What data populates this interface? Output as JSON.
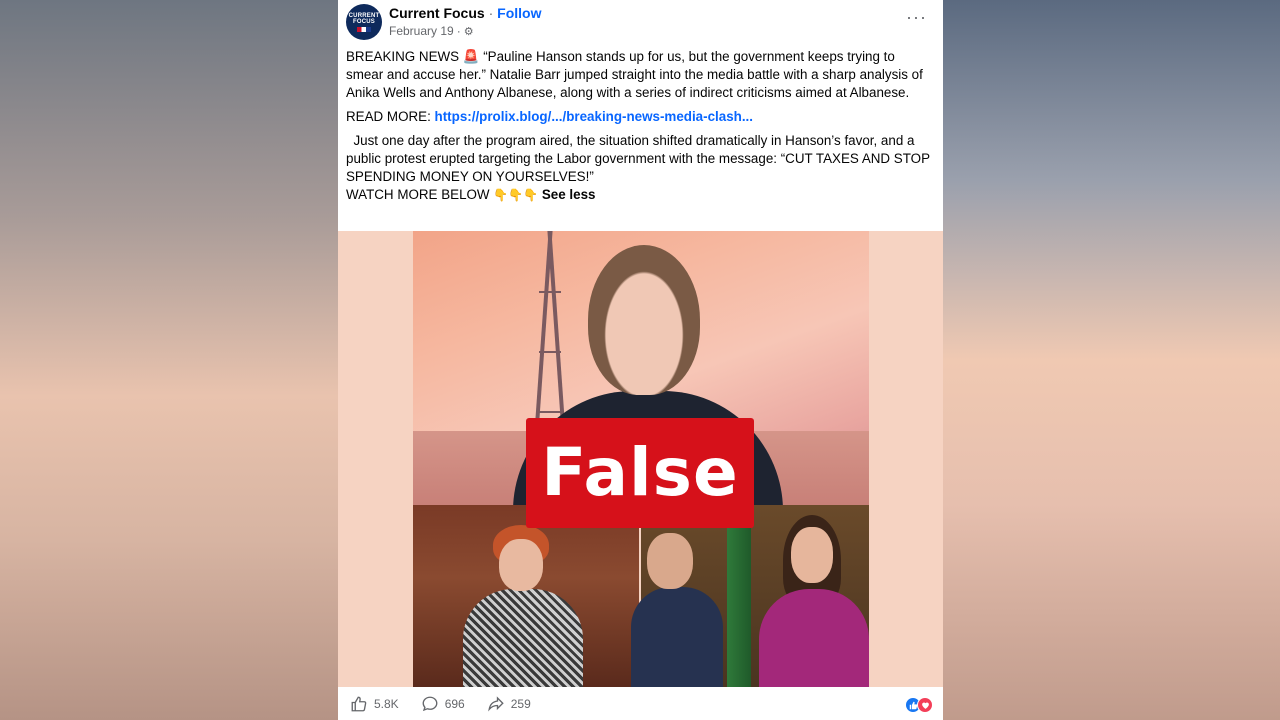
{
  "post": {
    "page_name": "Current Focus",
    "separator": "·",
    "follow_label": "Follow",
    "date": "February 19",
    "date_sep": "·",
    "avatar_text": [
      "CURRENT",
      "FOCUS"
    ],
    "more_label": "···",
    "body": {
      "p1": "BREAKING NEWS 🚨 “Pauline Hanson stands up for us, but the government keeps trying to smear and accuse her.” Natalie Barr jumped straight into the media battle with a sharp analysis of Anika Wells and Anthony Albanese, along with a series of indirect criticisms aimed at Albanese.",
      "read_more_label": "READ MORE: ",
      "read_more_link": "https://prolix.blog/.../breaking-news-media-clash...",
      "p3": "  Just one day after the program aired, the situation shifted dramatically in Hanson’s favor, and a public protest erupted targeting the Labor government with the message: “CUT TAXES AND STOP SPENDING MONEY ON YOURSELVES!”",
      "watch_more": "WATCH MORE BELOW ",
      "watch_emoji": "👇👇👇",
      "see_less": "See less"
    },
    "overlay_label": "False",
    "actions": {
      "likes": "5.8K",
      "comments": "696",
      "shares": "259"
    },
    "icons": {
      "like": "thumbs-up-icon",
      "comment": "comment-bubble-icon",
      "share": "share-arrow-icon",
      "settings": "gear-icon",
      "reaction_like": "like-reaction-icon",
      "reaction_love": "love-reaction-icon"
    },
    "colors": {
      "link": "#0866ff",
      "false_label": "#d6111a",
      "like": "#1877f2",
      "love": "#f33e58"
    }
  }
}
